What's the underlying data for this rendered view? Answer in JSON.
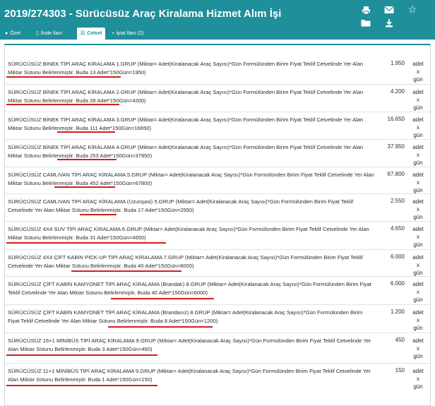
{
  "header": {
    "title": "2019/274303 - Sürücüsüz Araç Kiralama Hizmet Alım İşi",
    "icons": [
      "print-icon",
      "mail-icon",
      "star-icon",
      "folder-icon",
      "download-icon"
    ],
    "tabs": [
      {
        "icon": "info-icon",
        "label": "Özet"
      },
      {
        "icon": "document-icon",
        "label": "İhale İlanı"
      },
      {
        "icon": "table-icon",
        "label": "Cetvel"
      },
      {
        "icon": "cancel-icon",
        "label": "İptal İlanı (2)"
      }
    ],
    "active_tab": "Cetvel"
  },
  "rows": [
    {
      "desc": "SÜRÜCÜSÜZ BİNEK TİPİ ARAÇ KİRALAMA 1.GRUP (Miktar= Adet(Kiralanacak Araç Sayısı)*Gün Formülünden Birim Fiyat Teklif Cetvelinde Yer Alan Miktar Sütunu Belirlenmiştir. Buda 13 Adet*150Gün=1950)",
      "qty": "1.950",
      "unit": "adet x gün"
    },
    {
      "desc": "SÜRÜCÜSÜZ BİNEK TİPİ ARAÇ KİRALAMA 2.GRUP (Miktar= Adet(Kiralanacak Araç Sayısı)*Gün Formülünden Birim Fiyat Teklif Cetvelinde Yer Alan Miktar Sütunu Belirlenmiştir. Buda 28 Adet*150Gün=4200)",
      "qty": "4.200",
      "unit": "adet x gün"
    },
    {
      "desc": "SÜRÜCÜSÜZ BİNEK TİPİ ARAÇ KİRALAMA 3.GRUP (Miktar= Adet(Kiralanacak Araç Sayısı)*Gün Formülünden Birim Fiyat Teklif Cetvelinde Yer Alan Miktar Sütunu Belirlenmiştir. Buda 111 Adet*150Gün=16650)",
      "qty": "16.650",
      "unit": "adet x gün"
    },
    {
      "desc": "SÜRÜCÜSÜZ BİNEK TİPİ ARAÇ KİRALAMA 4.GRUP (Miktar= Adet(Kiralanacak Araç Sayısı)*Gün Formülünden Birim Fiyat Teklif Cetvelinde Yer Alan Miktar Sütunu Belirlenmiştir. Buda 253 Adet*150Gün=37950)",
      "qty": "37.950",
      "unit": "adet x gün"
    },
    {
      "desc": "SÜRÜCÜSÜZ CAMLIVAN TİPİ ARAÇ KİRALAMA 5.GRUP (Miktar= Adet(Kiralanacak Araç Sayısı)*Gün Formülünden Birim Fiyat Teklif Cetvelinde Yer Alan Miktar Sütunu Belirlenmiştir. Buda 452 Adet*150Gün=67800)",
      "qty": "67.800",
      "unit": "adet x gün"
    },
    {
      "desc": "SÜRÜCÜSÜZ CAMLIVAN TİPİ ARAÇ KİRALAMA (Uzunşasi) 5.GRUP (Miktar= Adet(Kiralanacak Araç Sayısı)*Gün Formülünden Birim Fiyat Teklif Cetvelinde Yer Alan Miktar Sütunu Belirlenmiştir. Buda 17 Adet*150Gün=2550)",
      "qty": "2.550",
      "unit": "adet x gün"
    },
    {
      "desc": "SÜRÜCÜSÜZ 4X4 SUV TİPİ ARAÇ KİRALAMA 6.GRUP (Miktar= Adet(Kiralanacak Araç Sayısı)*Gün Formülünden Birim Fiyat Teklif Cetvelinde Yer Alan Miktar Sütunu Belirlenmiştir. Buda 31 Adet*150Gün=4650)",
      "qty": "4.650",
      "unit": "adet x gün"
    },
    {
      "desc": "SÜRÜCÜSÜZ 4X4 ÇİFT KABİN PİCK-UP TİPİ ARAÇ KİRALAMA 7.GRUP (Miktar= Adet(Kiralanacak Araç Sayısı)*Gün Formülünden Birim Fiyat Teklif Cetvelinde Yer Alan Miktar Sütunu Belirlenmiştir. Buda 40 Adet*150Gün=6000)",
      "qty": "6.000",
      "unit": "adet x gün"
    },
    {
      "desc": "SÜRÜCÜSÜZ ÇİFT KABİN KAMYONET TİPİ ARAÇ KİRALAMA (Brandalı) 8.GRUP (Miktar= Adet(Kiralanacak Araç Sayısı)*Gün Formülünden Birim Fiyat Teklif Cetvelinde Yer Alan Miktar Sütunu Belirlenmiştir. Buda 40 Adet*150Gün=6000)",
      "qty": "6.000",
      "unit": "adet x gün"
    },
    {
      "desc": "SÜRÜCÜSÜZ ÇİFT KABİN KAMYONET TİPİ ARAÇ KİRALAMA (Brandasız) 8.GRUP (Miktar= Adet(Kiralanacak Araç Sayısı)*Gün Formülünden Birim Fiyat Teklif Cetvelinde Yer Alan Miktar Sütunu Belirlenmiştir. Buda 8 Adet*150Gün=1200)",
      "qty": "1.200",
      "unit": "adet x gün"
    },
    {
      "desc": "SÜRÜCÜSÜZ 16+1 MİNİBÜS TİPİ ARAÇ KİRALAMA 9.GRUP (Miktar= Adet(Kiralanacak Araç Sayısı)*Gün Formülünden Birim Fiyat Teklif Cetvelinde Yer Alan Miktar Sütunu Belirlenmiştir. Buda 3 Adet*150Gün=450)",
      "qty": "450",
      "unit": "adet x gün"
    },
    {
      "desc": "SÜRÜCÜSÜZ 11+1 MİNİBÜS TİPİ ARAÇ KİRALAMA 9.GRUP (Miktar= Adet(Kiralanacak Araç Sayısı)*Gün Formülünden Birim Fiyat Teklif Cetvelinde Yer Alan Miktar Sütunu Belirlenmiştir. Buda 1 Adet*150Gün=150)",
      "qty": "150",
      "unit": "adet x gün"
    }
  ],
  "colors": {
    "header": "#1f8f9a",
    "highlight": "#d21f1f",
    "border": "#dfe3e6"
  }
}
